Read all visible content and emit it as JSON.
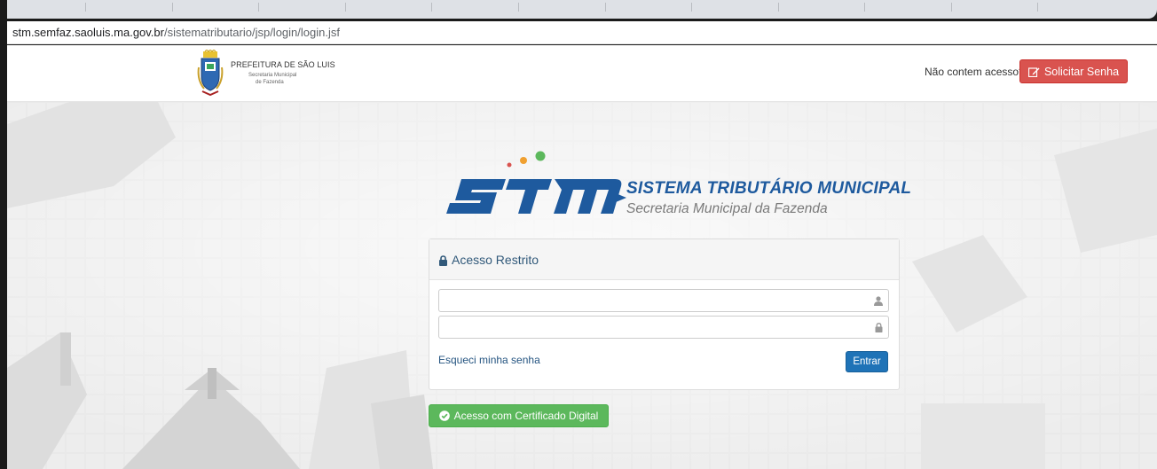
{
  "browser": {
    "url_host": "stm.semfaz.saoluis.ma.gov.br",
    "url_path": "/sistematributario/jsp/login/login.jsf"
  },
  "header": {
    "prefeitura_title": "PREFEITURA DE SÃO LUIS",
    "prefeitura_sub1": "Secretaria Municipal",
    "prefeitura_sub2": "de Fazenda",
    "no_access_text": "Não contem acesso?",
    "request_password_label": "Solicitar Senha"
  },
  "branding": {
    "system_title": "SISTEMA TRIBUTÁRIO MUNICIPAL",
    "system_subtitle": "Secretaria Municipal da Fazenda"
  },
  "login": {
    "panel_title": "Acesso Restrito",
    "username_value": "",
    "password_value": "",
    "forgot_label": "Esqueci minha senha",
    "submit_label": "Entrar"
  },
  "certificate": {
    "button_label": "Acesso com Certificado Digital"
  },
  "colors": {
    "danger": "#d9534f",
    "primary": "#1f73b7",
    "success": "#5cb85c",
    "brand_blue": "#1e5a9e"
  },
  "icons": {
    "lock": "lock-icon",
    "user": "user-icon",
    "edit": "edit-icon",
    "certificate": "check-circle-icon"
  }
}
